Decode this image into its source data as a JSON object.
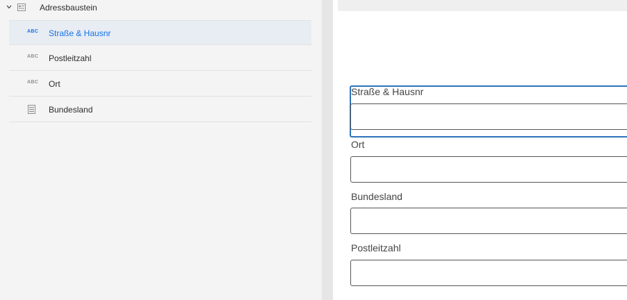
{
  "tree": {
    "parent": {
      "label": "Adressbaustein",
      "icon": "form-icon",
      "expanded": true
    },
    "items": [
      {
        "label": "Straße & Hausnr",
        "icon_text": "ABC",
        "icon": "text-field-icon",
        "selected": true
      },
      {
        "label": "Postleitzahl",
        "icon_text": "ABC",
        "icon": "text-field-icon",
        "selected": false
      },
      {
        "label": "Ort",
        "icon_text": "ABC",
        "icon": "text-field-icon",
        "selected": false
      },
      {
        "label": "Bundesland",
        "icon": "dropdown-list-icon",
        "selected": false
      }
    ]
  },
  "form": {
    "fields": [
      {
        "label": "Straße & Hausnr",
        "value": "",
        "selected": true
      },
      {
        "label": "Ort",
        "value": ""
      },
      {
        "label": "Bundesland",
        "value": ""
      },
      {
        "label": "Postleitzahl",
        "value": ""
      }
    ]
  },
  "colors": {
    "accent": "#1473e6",
    "selection_border": "#2d73b8",
    "selected_row_bg": "#e8ecf3"
  }
}
